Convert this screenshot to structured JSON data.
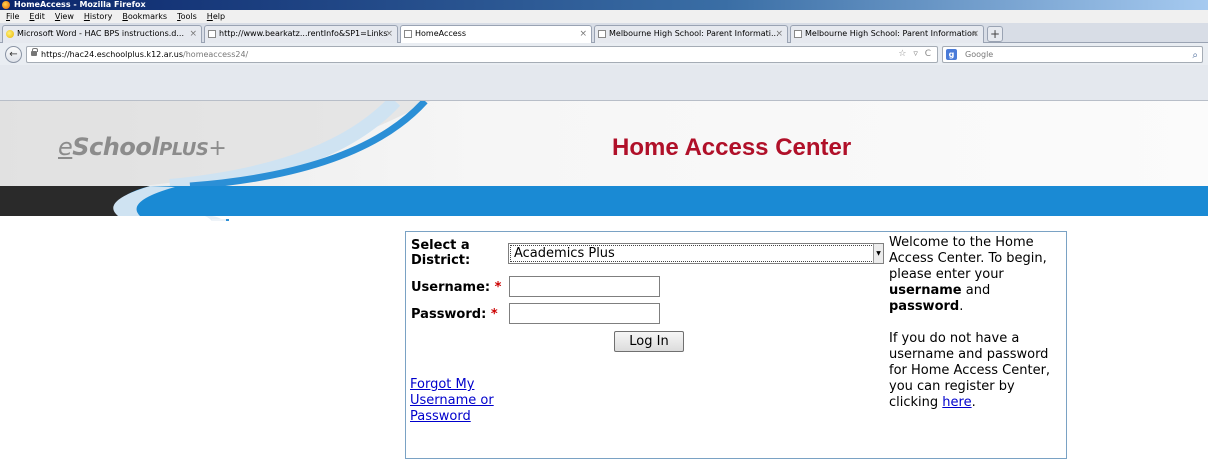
{
  "window": {
    "title": "HomeAccess - Mozilla Firefox"
  },
  "menu": [
    "File",
    "Edit",
    "View",
    "History",
    "Bookmarks",
    "Tools",
    "Help"
  ],
  "tabs": [
    {
      "label": "Microsoft Word - HAC BPS instructions.d...",
      "close": "×"
    },
    {
      "label": "http://www.bearkatz...rentInfo&SP1=Links",
      "close": "×"
    },
    {
      "label": "HomeAccess",
      "close": "×"
    },
    {
      "label": "Melbourne High School: Parent Informati...",
      "close": "×"
    },
    {
      "label": "Melbourne High School: Parent Information",
      "close": "×"
    }
  ],
  "newtab_label": "+",
  "nav": {
    "back_icon": "←",
    "url_scheme": "https://hac24.",
    "url_host": "eschoolplus.k12.ar.us",
    "url_path": "/homeaccess24/",
    "url_icons": "☆ ▿ C",
    "search_engine_icon": "g",
    "search_placeholder": "Google",
    "search_icon": "⌕"
  },
  "banner": {
    "logo_e": "e",
    "logo_school": "School",
    "logo_plus_sc": "PLUS",
    "logo_plus_sign": "+",
    "title": "Home Access Center"
  },
  "login": {
    "district_label_line1": "Select a",
    "district_label_line2": "District:",
    "district_value": "Academics Plus",
    "district_arrow": "▼",
    "username_label": "Username:",
    "password_label": "Password:",
    "required_mark": "*",
    "login_button": "Log In",
    "forgot_link": "Forgot My Username or Password"
  },
  "welcome": {
    "p1_a": "Welcome to the Home Access Center. To begin, please enter your ",
    "p1_b": "username",
    "p1_c": " and ",
    "p1_d": "password",
    "p1_e": ".",
    "p2_a": "If you do not have a username and password for Home Access Center, you can register by clicking ",
    "p2_link": "here",
    "p2_b": "."
  },
  "colors": {
    "title_red": "#b01029",
    "band_blue": "#1a8ad4",
    "link_blue": "#0000cc",
    "required_red": "#cc0000"
  }
}
